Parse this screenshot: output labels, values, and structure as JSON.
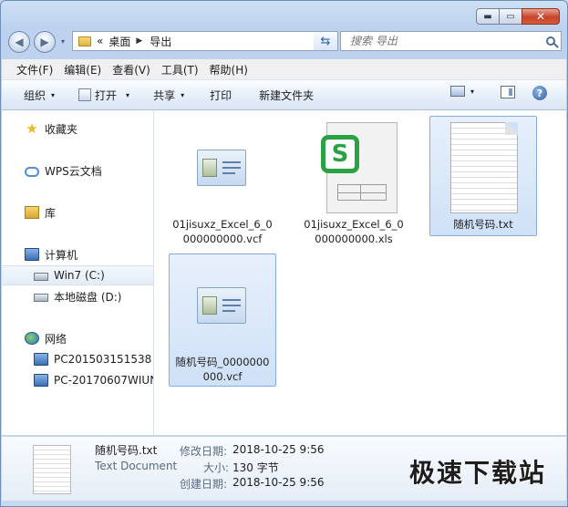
{
  "window": {
    "caption_buttons": {
      "minimize": "▬",
      "maximize": "▭",
      "close": "✕"
    }
  },
  "navbar": {
    "back_icon": "◀",
    "forward_icon": "▶",
    "dropdown_icon": "▾",
    "address_prefix": "«",
    "crumbs": [
      "桌面",
      "导出"
    ],
    "crumb_arrow": "▶",
    "address_dropdown": "▾",
    "refresh_icon": "⇆",
    "search_placeholder": "搜索 导出"
  },
  "menu": [
    "文件(F)",
    "编辑(E)",
    "查看(V)",
    "工具(T)",
    "帮助(H)"
  ],
  "toolbar": {
    "organize": "组织",
    "open": "打开",
    "share": "共享",
    "print": "打印",
    "new_folder": "新建文件夹",
    "dd": "▾",
    "help": "?"
  },
  "sidebar": {
    "items": [
      {
        "label": "收藏夹",
        "icon": "star-icon"
      },
      {
        "label": "WPS云文档",
        "icon": "cloud-icon"
      },
      {
        "label": "库",
        "icon": "library-icon"
      },
      {
        "label": "计算机",
        "icon": "computer-icon"
      },
      {
        "label": "Win7 (C:)",
        "icon": "drive-icon"
      },
      {
        "label": "本地磁盘 (D:)",
        "icon": "drive-icon"
      },
      {
        "label": "网络",
        "icon": "network-icon"
      },
      {
        "label": "PC201503151538",
        "icon": "computer-icon"
      },
      {
        "label": "PC-20170607WIUN",
        "icon": "computer-icon"
      }
    ],
    "star_glyph": "★"
  },
  "files": [
    {
      "name": "01jisuxz_Excel_6_0000000000.vcf",
      "type": "vcf",
      "selected": false
    },
    {
      "name": "01jisuxz_Excel_6_0000000000.xls",
      "type": "xls",
      "selected": false
    },
    {
      "name": "随机号码.txt",
      "type": "txt",
      "selected": true
    },
    {
      "name": "随机号码_0000000000.vcf",
      "type": "vcf",
      "selected": true
    }
  ],
  "xls_logo": "S",
  "details": {
    "filename": "随机号码.txt",
    "filetype": "Text Document",
    "modified_label": "修改日期:",
    "modified_value": "2018-10-25 9:56",
    "size_label": "大小:",
    "size_value": "130 字节",
    "created_label": "创建日期:",
    "created_value": "2018-10-25 9:56"
  },
  "watermark": "极速下载站"
}
